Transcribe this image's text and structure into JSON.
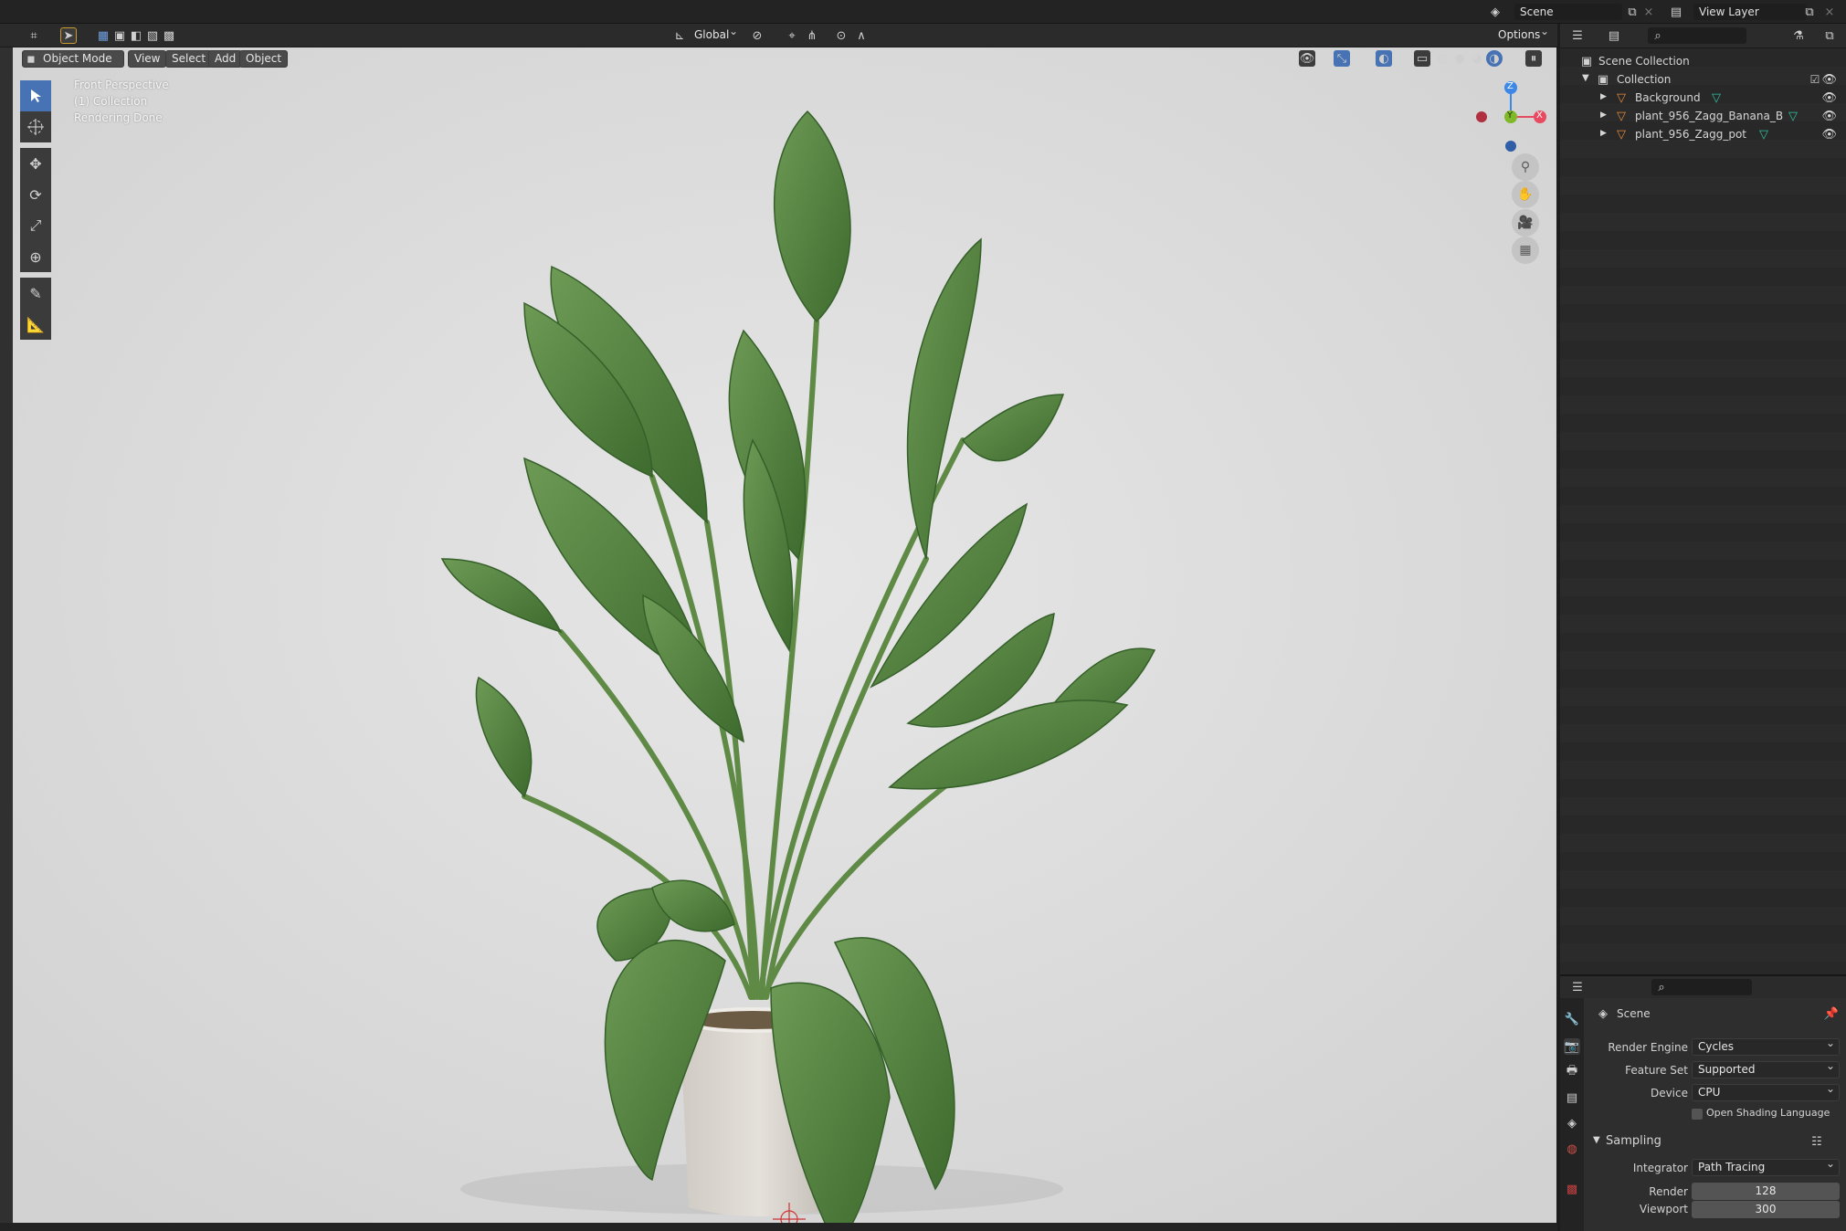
{
  "topbar": {
    "scene_name": "Scene",
    "view_layer_name": "View Layer"
  },
  "header3d": {
    "mode": "Object Mode",
    "menus": [
      "View",
      "Select",
      "Add",
      "Object"
    ],
    "transform_orientation": "Global",
    "options_label": "Options"
  },
  "viewport": {
    "overlay_lines": [
      "Front Perspective",
      "(1) Collection",
      "Rendering Done"
    ],
    "gizmo_axes": {
      "z": "Z",
      "y": "Y",
      "x": "X"
    },
    "background_color": "#dcdcdc"
  },
  "toolbar": {
    "tools": [
      "select-box-icon",
      "cursor-icon",
      "move-icon",
      "rotate-icon",
      "scale-icon",
      "transform-icon",
      "annotate-icon",
      "measure-icon"
    ]
  },
  "outliner": {
    "root": "Scene Collection",
    "collection": "Collection",
    "objects": [
      "Background",
      "plant_956_Zagg_Banana_B",
      "plant_956_Zagg_pot"
    ]
  },
  "properties": {
    "context_label": "Scene",
    "render_engine_label": "Render Engine",
    "render_engine": "Cycles",
    "feature_set_label": "Feature Set",
    "feature_set": "Supported",
    "device_label": "Device",
    "device": "CPU",
    "osl_label": "Open Shading Language",
    "sampling_label": "Sampling",
    "integrator_label": "Integrator",
    "integrator": "Path Tracing",
    "render_label": "Render",
    "render_samples": "128",
    "viewport_label": "Viewport",
    "viewport_samples": "300"
  },
  "colors": {
    "accent": "#4772b3",
    "axis_x": "#e84a5f",
    "axis_y": "#7fb929",
    "axis_z": "#3d87e6",
    "leaf_green": "#4f7f3c",
    "mesh_icon": "#e58a3a"
  }
}
